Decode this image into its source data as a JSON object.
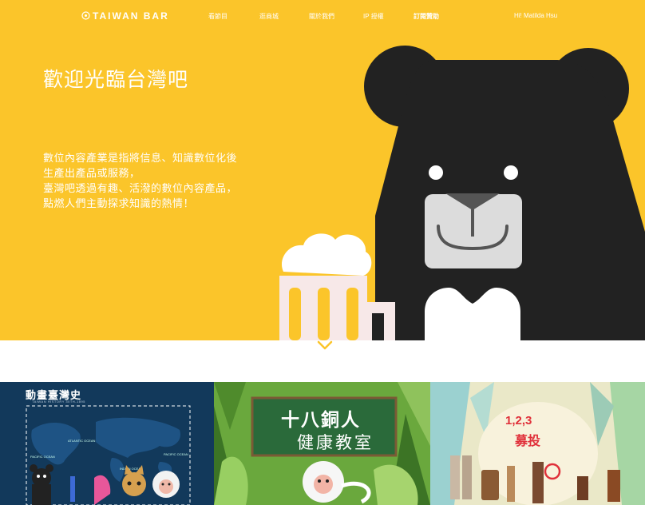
{
  "nav": {
    "logo": "TAIWAN BAR",
    "items": [
      {
        "label": "看節目"
      },
      {
        "label": "逛商城"
      },
      {
        "label": "關於我們"
      },
      {
        "label": "IP 授權"
      },
      {
        "label": "訂閱贊助"
      }
    ],
    "user_greeting": "Hi! Matilda Hsu"
  },
  "hero": {
    "title": "歡迎光臨台灣吧",
    "intro_lines": [
      "數位內容產業是指將信息、知識數位化後",
      "生產出產品或服務，",
      "臺灣吧透過有趣、活潑的數位內容產品，",
      "點燃人們主動探求知識的熱情！"
    ]
  },
  "cards": [
    {
      "title": "動畫臺灣史",
      "subtitle": "TAIWAN HISTORY 30TH-1895",
      "map_labels": [
        "ATLANTIC OCEAN",
        "PACIFIC OCEAN",
        "INDIAN OCEAN",
        "PACIFIC OCEAN"
      ]
    },
    {
      "title_line1": "十八銅人",
      "title_line2": "健康教室"
    },
    {
      "title_line1": "1,2,3",
      "title_line2": "募投"
    }
  ],
  "colors": {
    "hero_bg": "#fbc52a",
    "bear": "#222222",
    "card1_bg": "#12395b",
    "card2_bg": "#6aa83d",
    "card3_bg": "#eae8c8"
  }
}
